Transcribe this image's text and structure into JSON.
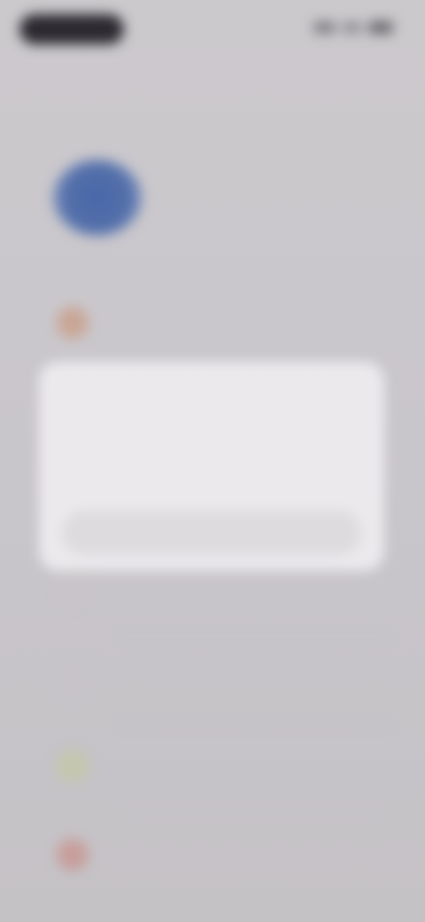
{
  "status_bar": {
    "time": "",
    "right_icons": [
      "signal-icon",
      "wifi-icon",
      "battery-icon"
    ]
  },
  "header": {
    "back_label": ""
  },
  "profile": {
    "name": "",
    "subtitle": "",
    "avatar_color": "#4866a8"
  },
  "settings": {
    "items": [
      {
        "label": "",
        "icon": "settings-item-icon",
        "icon_color": "#c9a695"
      },
      {
        "label": "",
        "icon": "settings-item-icon",
        "icon_color": "#c8c4c9"
      },
      {
        "label": "",
        "icon": "settings-item-icon",
        "icon_color": "#c7c3c9"
      },
      {
        "label": "",
        "icon": "settings-item-icon",
        "icon_color": "#c4c6ac"
      },
      {
        "label": "",
        "icon": "settings-item-icon",
        "icon_color": "#c79e9b"
      }
    ]
  },
  "dialog": {
    "title": "",
    "body": "",
    "button_label": ""
  }
}
